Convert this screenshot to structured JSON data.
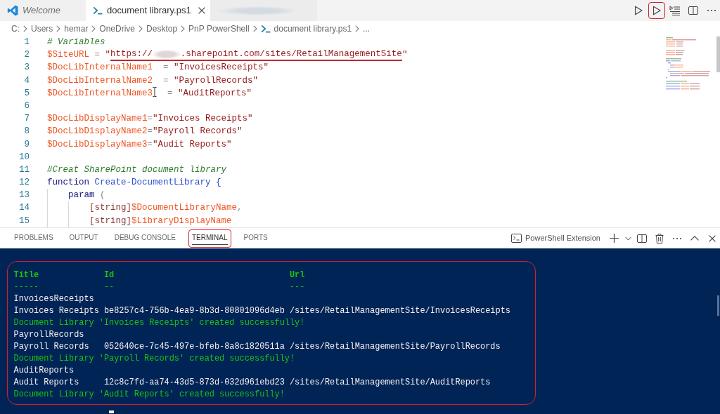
{
  "editor_tabs": [
    {
      "kind": "welcome",
      "label": "Welcome",
      "preview": true,
      "selected": false
    },
    {
      "kind": "script",
      "label": "document library.ps1",
      "preview": false,
      "selected": true
    },
    {
      "kind": "blurred",
      "selected": false
    }
  ],
  "editor_actions": [
    {
      "kind": "play",
      "outlined": false
    },
    {
      "kind": "play",
      "outlined": true
    },
    {
      "kind": "run-lines",
      "outlined": false
    },
    {
      "kind": "split",
      "outlined": false
    },
    {
      "kind": "more",
      "outlined": false
    }
  ],
  "breadcrumbs": [
    {
      "kind": "segment",
      "text": "C:"
    },
    {
      "kind": "segment",
      "text": "Users"
    },
    {
      "kind": "segment",
      "text": "hemar"
    },
    {
      "kind": "segment",
      "text": "OneDrive"
    },
    {
      "kind": "segment",
      "text": "Desktop"
    },
    {
      "kind": "segment",
      "text": "PnP PowerShell"
    },
    {
      "kind": "file",
      "text": "document library.ps1"
    },
    {
      "kind": "segment",
      "text": "..."
    }
  ],
  "editor": {
    "lines": [
      {
        "number": "1",
        "tokens": [
          {
            "kind": "comment",
            "text": "# Variables"
          }
        ]
      },
      {
        "number": "2",
        "tokens": [
          {
            "kind": "variable",
            "text": "$SiteURL",
            "underlined": false
          },
          {
            "kind": "operator",
            "text": " = ",
            "underlined": false
          },
          {
            "kind": "string",
            "text": "\"",
            "underlined": false
          },
          {
            "kind": "string",
            "text": "https://",
            "underlined": true
          },
          {
            "kind": "redacted",
            "underlined": true
          },
          {
            "kind": "string",
            "text": ".sharepoint.com/sites/RetailManagementSite",
            "underlined": true
          },
          {
            "kind": "string",
            "text": "\"",
            "underlined": false
          }
        ]
      },
      {
        "number": "3",
        "tokens": [
          {
            "kind": "variable",
            "text": "$DocLibInternalName1"
          },
          {
            "kind": "operator",
            "text": "  = "
          },
          {
            "kind": "string",
            "text": "\"InvoicesReceipts\""
          }
        ]
      },
      {
        "number": "4",
        "tokens": [
          {
            "kind": "variable",
            "text": "$DocLibInternalName2"
          },
          {
            "kind": "operator",
            "text": "  = "
          },
          {
            "kind": "string",
            "text": "\"PayrollRecords\""
          }
        ]
      },
      {
        "number": "5",
        "tokens": [
          {
            "kind": "variable",
            "text": "$DocLibInternalName3"
          },
          {
            "kind": "pointer"
          },
          {
            "kind": "operator",
            "text": "  = "
          },
          {
            "kind": "string",
            "text": "\"AuditReports\""
          }
        ]
      },
      {
        "number": "6"
      },
      {
        "number": "7",
        "tokens": [
          {
            "kind": "variable",
            "text": "$DocLibDisplayName1"
          },
          {
            "kind": "operator",
            "text": "="
          },
          {
            "kind": "string",
            "text": "\"Invoices Receipts\""
          }
        ]
      },
      {
        "number": "8",
        "tokens": [
          {
            "kind": "variable",
            "text": "$DocLibDisplayName2"
          },
          {
            "kind": "operator",
            "text": "="
          },
          {
            "kind": "string",
            "text": "\"Payroll Records\""
          }
        ]
      },
      {
        "number": "9",
        "tokens": [
          {
            "kind": "variable",
            "text": "$DocLibDisplayName3"
          },
          {
            "kind": "operator",
            "text": "="
          },
          {
            "kind": "string",
            "text": "\"Audit Reports\""
          }
        ]
      },
      {
        "number": "10"
      },
      {
        "number": "11",
        "tokens": [
          {
            "kind": "comment",
            "text": "#Creat SharePoint document library"
          }
        ]
      },
      {
        "number": "12",
        "tokens": [
          {
            "kind": "keyword",
            "text": "function"
          },
          {
            "kind": "command",
            "text": " Create-DocumentLibrary {"
          }
        ]
      },
      {
        "number": "13",
        "tokens": [
          {
            "kind": "keyword",
            "text": "    param"
          },
          {
            "kind": "operator",
            "text": " ("
          }
        ]
      },
      {
        "number": "14",
        "tokens": [
          {
            "kind": "type",
            "text": "        [string]"
          },
          {
            "kind": "variable",
            "text": "$DocumentLibraryName"
          },
          {
            "kind": "operator",
            "text": ","
          }
        ]
      },
      {
        "number": "15",
        "tokens": [
          {
            "kind": "type",
            "text": "        [string]"
          },
          {
            "kind": "variable",
            "text": "$LibraryDisplayName"
          }
        ]
      }
    ]
  },
  "panel": {
    "tabs": [
      {
        "label": "PROBLEMS",
        "selected": false,
        "outlined": false
      },
      {
        "label": "OUTPUT",
        "selected": false,
        "outlined": false
      },
      {
        "label": "DEBUG CONSOLE",
        "selected": false,
        "outlined": false
      },
      {
        "label": "TERMINAL",
        "selected": true,
        "outlined": true
      },
      {
        "label": "PORTS",
        "selected": false,
        "outlined": false
      }
    ],
    "actions": [
      {
        "kind": "terminal",
        "label": "PowerShell Extension"
      },
      {
        "kind": "plus"
      },
      {
        "kind": "chevron-down"
      },
      {
        "kind": "split"
      },
      {
        "kind": "trash"
      },
      {
        "kind": "more"
      },
      {
        "kind": "chevron-up"
      },
      {
        "kind": "close"
      }
    ]
  },
  "terminal": {
    "outlined": true,
    "lines": [
      {
        "kind": "header",
        "cells": [
          "Title",
          "Id",
          "Url"
        ]
      },
      {
        "kind": "rule",
        "cells": [
          "-----",
          "--",
          "---"
        ]
      },
      {
        "kind": "text",
        "text": "InvoicesReceipts"
      },
      {
        "kind": "row",
        "cells": [
          "Invoices Receipts",
          "be8257c4-756b-4ea9-8b3d-80801096d4eb",
          "/sites/RetailManagementSite/InvoicesReceipts"
        ]
      },
      {
        "kind": "success",
        "text": "Document Library 'Invoices Receipts' created successfully!"
      },
      {
        "kind": "text",
        "text": "PayrollRecords"
      },
      {
        "kind": "row",
        "cells": [
          "Payroll Records",
          "052640ce-7c45-497e-bfeb-8a8c1820511a",
          "/sites/RetailManagementSite/PayrollRecords"
        ]
      },
      {
        "kind": "success",
        "text": "Document Library 'Payroll Records' created successfully!"
      },
      {
        "kind": "text",
        "text": "AuditReports"
      },
      {
        "kind": "row",
        "cells": [
          "Audit Reports",
          "12c8c7fd-aa74-43d5-873d-032d961ebd23",
          "/sites/RetailManagementSite/AuditReports"
        ]
      },
      {
        "kind": "success",
        "text": "Document Library 'Audit Reports' created successfully!"
      }
    ]
  }
}
